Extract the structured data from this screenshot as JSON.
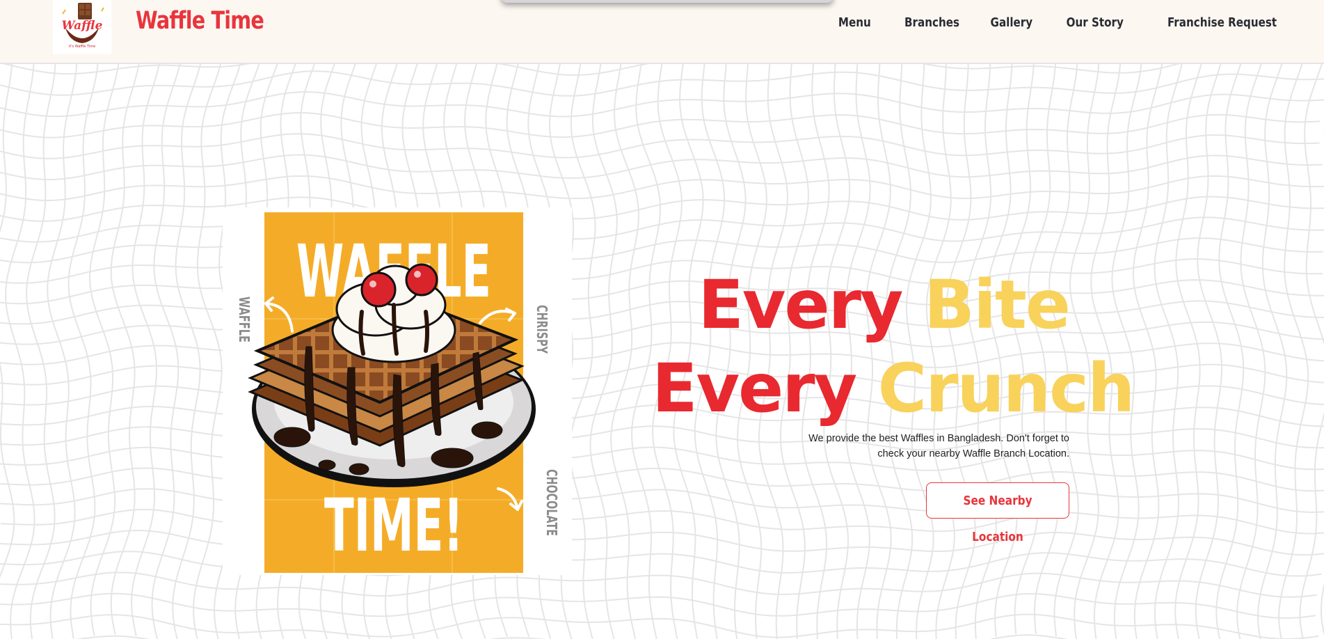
{
  "brand": {
    "title": "Waffle Time",
    "logo_text": "Waffle",
    "logo_tagline": "it's Waffle Time",
    "logo_icon": "chocolate-waffle-logo",
    "accent_color": "#e8353c"
  },
  "nav": {
    "items": [
      {
        "label": "Menu"
      },
      {
        "label": "Branches"
      },
      {
        "label": "Gallery"
      },
      {
        "label": "Our Story"
      },
      {
        "label": "Franchise Request"
      }
    ]
  },
  "poster": {
    "top_text": "WAFFLE",
    "bottom_text": "TIME!",
    "side_left": "WAFFLE",
    "side_right_top": "CHRISPY",
    "side_right_bottom": "CHOCOLATE",
    "background_color": "#f4ac28"
  },
  "hero": {
    "line1_red": "Every",
    "line1_yellow": "Bite",
    "line2_red": "Every",
    "line2_yellow": "Crunch",
    "description": "We provide the best Waffles in Bangladesh. Don't forget to check your nearby Waffle Branch Location.",
    "cta_label": "See Nearby Location",
    "red_color": "#e8292f",
    "yellow_color": "#f8d25b"
  }
}
